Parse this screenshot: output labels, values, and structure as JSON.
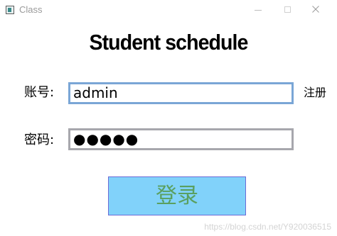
{
  "window": {
    "title": "Class",
    "icon": "app-window-icon",
    "controls": [
      "minimize-icon",
      "maximize-icon",
      "close-icon"
    ]
  },
  "header": {
    "title": "Student schedule"
  },
  "form": {
    "account_label": "账号:",
    "account_value": "admin",
    "password_label": "密码:",
    "password_value": "●●●●●",
    "register_label": "注册",
    "login_label": "登录"
  },
  "watermark": {
    "text": "https://blog.csdn.net/Y920036515"
  },
  "colors": {
    "account_border": "#7aa6d6",
    "password_border": "#a7a7ad",
    "login_background": "#81d2fa",
    "login_text": "#5aa060",
    "login_border": "#6b6bd6"
  }
}
